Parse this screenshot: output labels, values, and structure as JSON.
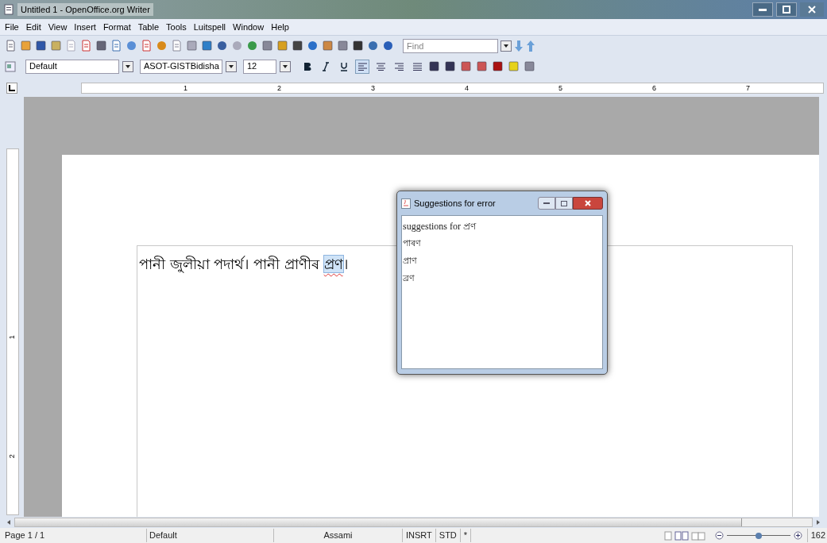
{
  "window": {
    "title": "Untitled 1 - OpenOffice.org Writer"
  },
  "menu": [
    "File",
    "Edit",
    "View",
    "Insert",
    "Format",
    "Table",
    "Tools",
    "Luitspell",
    "Window",
    "Help"
  ],
  "find_toolbar": {
    "placeholder": "Find"
  },
  "formatting": {
    "style": "Default",
    "font": "ASOT-GISTBidisha",
    "size": "12",
    "bold": false,
    "italic": false,
    "underline": false,
    "align_left": true
  },
  "ruler": {
    "labels": [
      "1",
      "2",
      "3",
      "4",
      "5",
      "6",
      "7"
    ]
  },
  "vertical_ruler": {
    "labels": [
      "1",
      "2"
    ]
  },
  "document": {
    "segments": [
      {
        "kind": "normal",
        "text": "পানী জুলীয়া পদাৰ্থ। পানী প্ৰাণীৰ "
      },
      {
        "kind": "misspelled",
        "text": "প্ৰণ"
      },
      {
        "kind": "normal",
        "text": "।"
      }
    ]
  },
  "dialog": {
    "title": "Suggestions for error",
    "heading": "suggestions for প্ৰণ",
    "suggestions": [
      "পাৰণ",
      "প্ৰাণ",
      "ব্ৰণ"
    ]
  },
  "status_bar": {
    "page": "Page 1 / 1",
    "style": "Default",
    "language": "Assami",
    "insert_mode": "INSRT",
    "selection_mode": "STD",
    "modified": "*",
    "zoom": "162",
    "zoom_slider": {
      "level": 0.5
    }
  }
}
